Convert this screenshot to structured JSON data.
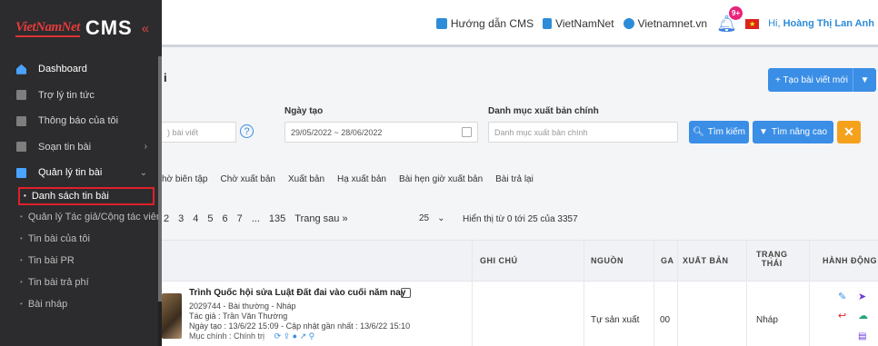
{
  "header": {
    "links": [
      {
        "label": "Hướng dẫn CMS",
        "icon": "book-icon",
        "color": "#2d8cd8"
      },
      {
        "label": "VietNamNet",
        "icon": "building-icon",
        "color": "#2d8cd8"
      },
      {
        "label": "Vietnamnet.vn",
        "icon": "globe-icon",
        "color": "#2d8cd8"
      }
    ],
    "notification_count": "9+",
    "greeting_prefix": "Hi, ",
    "user_name": "Hoàng Thị Lan Anh"
  },
  "logo": {
    "brand": "VietNamNet",
    "product": "CMS",
    "collapse_glyph": "«"
  },
  "sidebar": {
    "items": [
      {
        "label": "Dashboard",
        "icon": "home-icon",
        "state": "active"
      },
      {
        "label": "Trợ lý tin tức",
        "icon": "assistant-icon"
      },
      {
        "label": "Thông báo của tôi",
        "icon": "bell-icon"
      },
      {
        "label": "Soạn tin bài",
        "icon": "edit-icon",
        "caret": "›"
      },
      {
        "label": "Quản lý tin bài",
        "icon": "folder-icon",
        "caret": "⌄",
        "state": "open"
      }
    ],
    "subitems": [
      {
        "label": "Danh sách tin bài",
        "selected": true
      },
      {
        "label": "Quản lý Tác giả/Cộng tác viên"
      },
      {
        "label": "Tin bài của tôi"
      },
      {
        "label": "Tin bài PR"
      },
      {
        "label": "Tin bài trả phí"
      },
      {
        "label": "Bài nháp"
      }
    ]
  },
  "main": {
    "page_title": "i",
    "new_post_button": "+ Tạo bài viết mới",
    "filters": {
      "search_placeholder": ") bài viết",
      "date_label": "Ngày tạo",
      "date_value": "29/05/2022 ~ 28/06/2022",
      "category_label": "Danh mục xuất bản chính",
      "category_placeholder": "Danh mục xuất bản chính",
      "search_button": "Tìm kiếm",
      "advanced_button": "Tìm nâng cao",
      "clear_button": "✕"
    },
    "tabs": [
      "hờ biên tập",
      "Chờ xuất bản",
      "Xuất bản",
      "Hạ xuất bản",
      "Bài hẹn giờ xuất bản",
      "Bài trả lại"
    ],
    "pagination": {
      "pages": [
        "2",
        "3",
        "4",
        "5",
        "6",
        "7",
        "...",
        "135"
      ],
      "next": "Trang sau »",
      "per_page": "25",
      "showing": "Hiển thị từ 0 tới 25 của 3357"
    },
    "table": {
      "headers": {
        "note": "GHI CHÚ",
        "source": "NGUỒN",
        "ga": "GA",
        "publish": "XUẤT BẢN",
        "status_line1": "TRẠNG",
        "status_line2": "THÁI",
        "actions": "HÀNH ĐỘNG"
      },
      "rows": [
        {
          "title": "Trình Quốc hội sửa Luật Đất đai vào cuối năm nay",
          "line2": "2029744 - Bài thường - Nháp",
          "line3": "Tác giả : Trần Văn Thường",
          "line4": "Ngày tạo : 13/6/22 15:09 - Cập nhật gần nhất : 13/6/22 15:10",
          "line5": "Mục chính : Chính trị",
          "note": "",
          "source": "Tự sản xuất",
          "ga": "00",
          "publish": "",
          "status": "Nháp"
        }
      ]
    }
  }
}
